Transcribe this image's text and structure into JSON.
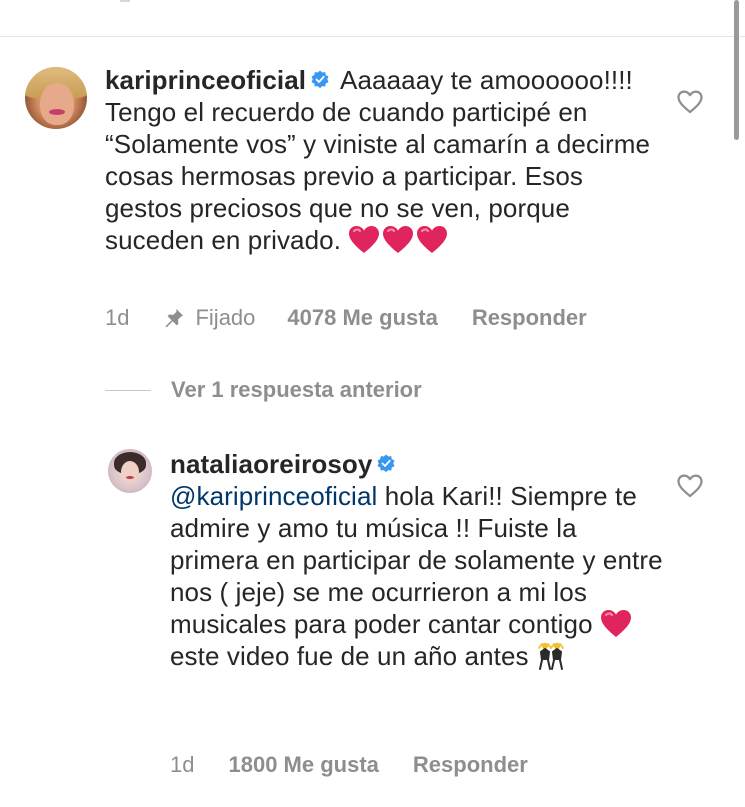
{
  "comments": [
    {
      "username": "kariprinceoficial",
      "text": "Aaaaaay te amoooooo!!!! Tengo el recuerdo de cuando participé en “Solamente vos” y viniste al camarín a decirme cosas hermosas previo a participar. Esos gestos preciosos que no se ven, porque suceden en privado.",
      "time": "1d",
      "pinned_label": "Fijado",
      "likes": "4078 Me gusta",
      "reply_label": "Responder"
    }
  ],
  "view_replies": "Ver 1 respuesta anterior",
  "reply": {
    "username": "nataliaoreirosoy",
    "mention": "@kariprinceoficial",
    "text_part1": "hola Kari!! Siempre te admire y amo tu música !! Fuiste la primera en participar de solamente y entre nos ( jeje) se me ocurrieron a mi los musicales para poder cantar contigo",
    "text_part2": "este video fue de un año antes",
    "time": "1d",
    "likes": "1800 Me gusta",
    "reply_label": "Responder"
  },
  "icons": {
    "verified": "verified-badge-icon",
    "like": "heart-outline-icon",
    "pin": "pin-icon",
    "emoji_heart": "red-heart-emoji",
    "emoji_dancers": "dancers-emoji"
  },
  "colors": {
    "text": "#262626",
    "muted": "#8e8e8e",
    "mention": "#00376b",
    "verified": "#3897f0",
    "heart": "#e0245e"
  }
}
